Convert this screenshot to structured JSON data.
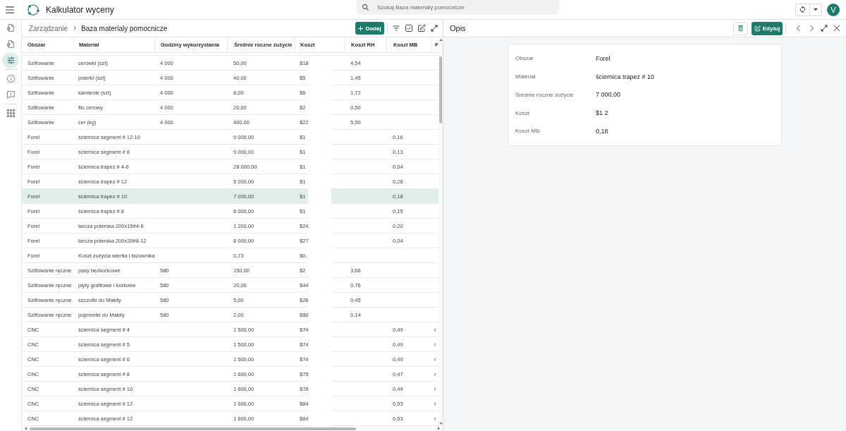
{
  "app": {
    "title": "Kalkulator wyceny",
    "search": {
      "placeholder": "Szukaj Baza materialy pomocnicze"
    },
    "avatar": "V"
  },
  "sidebar": {
    "groups": [
      {
        "items": [
          {
            "kind": "document",
            "selected": false
          },
          {
            "kind": "document",
            "selected": false
          },
          {
            "kind": "sliders",
            "selected": true
          }
        ]
      },
      {
        "items": [
          {
            "kind": "info",
            "selected": false
          },
          {
            "kind": "feedback",
            "selected": false
          }
        ]
      },
      {
        "items": [
          {
            "kind": "apps",
            "selected": false
          }
        ]
      }
    ]
  },
  "list_panel": {
    "breadcrumb": [
      "Zarządzanie",
      "Baza materialy pomocnicze"
    ],
    "add_button": "Dodaj",
    "table": {
      "columns": [
        "Obszar",
        "Materiał",
        "Godziny wykorzystania",
        "Średnie roczne zużycie",
        "Koszt",
        "Koszt RH",
        "Koszt MB",
        "F"
      ],
      "rows": [
        {
          "selected": false,
          "area": "Szlifowanie",
          "material": "cerówki (szt)",
          "usage_hours": "4 000",
          "avg_annual_use": "50,00",
          "cost": "$18",
          "cost_rh": "4,54"
        },
        {
          "selected": false,
          "area": "Szlifowanie",
          "material": "polerki (szt)",
          "usage_hours": "4 000",
          "avg_annual_use": "40,00",
          "cost": "$5",
          "cost_rh": "1,45"
        },
        {
          "selected": false,
          "area": "Szlifowanie",
          "material": "kamienie (szt)",
          "usage_hours": "4 000",
          "avg_annual_use": "8,00",
          "cost": "$6",
          "cost_rh": "1,72"
        },
        {
          "selected": false,
          "area": "Szlifowanie",
          "material": "filc cerowy",
          "usage_hours": "4 000",
          "avg_annual_use": "20,00",
          "cost": "$2",
          "cost_rh": "0,50"
        },
        {
          "selected": false,
          "area": "Szlifowanie",
          "material": "cer (kg)",
          "usage_hours": "4 000",
          "avg_annual_use": "400,00",
          "cost": "$22",
          "cost_rh": "5,50"
        },
        {
          "selected": false,
          "area": "Forel",
          "material": "ściernica segment # 12-10",
          "avg_annual_use": "9 000,00",
          "cost": "$1",
          "cost_mb": "0,16"
        },
        {
          "selected": false,
          "area": "Forel",
          "material": "ściernica segment # 8",
          "avg_annual_use": "9 000,00",
          "cost": "$1",
          "cost_mb": "0,13"
        },
        {
          "selected": false,
          "area": "Forel",
          "material": "ściernica trapez # 4-6",
          "avg_annual_use": "28 000,00",
          "cost": "$1",
          "cost_mb": "0,04"
        },
        {
          "selected": false,
          "area": "Forel",
          "material": "ściernica trapez # 12",
          "avg_annual_use": "5 000,00",
          "cost": "$1",
          "cost_mb": "0,28"
        },
        {
          "selected": true,
          "area": "Forel",
          "material": "ściernica trapez # 10",
          "avg_annual_use": "7 000,00",
          "cost": "$1",
          "cost_mb": "0,18"
        },
        {
          "selected": false,
          "area": "Forel",
          "material": "ściernica trapez # 8",
          "avg_annual_use": "8 000,00",
          "cost": "$1",
          "cost_mb": "0,15"
        },
        {
          "selected": false,
          "area": "Forel",
          "material": "tarcza polerska 200x15#4-6",
          "avg_annual_use": "1 200,00",
          "cost": "$24",
          "cost_mb": "0,20"
        },
        {
          "selected": false,
          "area": "Forel",
          "material": "tarcza polerska 200x20#8-12",
          "avg_annual_use": "8 000,00",
          "cost": "$27",
          "cost_mb": "0,04"
        },
        {
          "selected": false,
          "area": "Forel",
          "material": "Koszt zużycia wiertła i fazownika",
          "avg_annual_use": "0,73",
          "cost": "$0,"
        },
        {
          "selected": false,
          "area": "Szlifowanie ręczne",
          "material": "pasy bezkońcowe",
          "usage_hours": "580",
          "avg_annual_use": "150,00",
          "cost": "$2",
          "cost_rh": "3,66"
        },
        {
          "selected": false,
          "area": "Szlifowanie ręczne",
          "material": "płyty grafitowe i korkowe",
          "usage_hours": "580",
          "avg_annual_use": "20,00",
          "cost": "$44",
          "cost_rh": "0,76"
        },
        {
          "selected": false,
          "area": "Szlifowanie ręczne",
          "material": "szczotki do Makity",
          "usage_hours": "580",
          "avg_annual_use": "5,00",
          "cost": "$26",
          "cost_rh": "0,45"
        },
        {
          "selected": false,
          "area": "Szlifowanie ręczne",
          "material": "pojemniki do Makity",
          "usage_hours": "580",
          "avg_annual_use": "2,00",
          "cost": "$80",
          "cost_rh": "0,14"
        },
        {
          "selected": false,
          "area": "CNC",
          "material": "ściernica segment # 4",
          "avg_annual_use": "1 500,00",
          "cost": "$74",
          "cost_mb": "0,49",
          "column_8": "r"
        },
        {
          "selected": false,
          "area": "CNC",
          "material": "ściernica segment # 5",
          "avg_annual_use": "1 500,00",
          "cost": "$74",
          "cost_mb": "0,49",
          "column_8": "r"
        },
        {
          "selected": false,
          "area": "CNC",
          "material": "ściernica segment # 6",
          "avg_annual_use": "1 500,00",
          "cost": "$74",
          "cost_mb": "0,49",
          "column_8": "r"
        },
        {
          "selected": false,
          "area": "CNC",
          "material": "ściernica segment # 8",
          "avg_annual_use": "1 600,00",
          "cost": "$75",
          "cost_mb": "0,47",
          "column_8": "r"
        },
        {
          "selected": false,
          "area": "CNC",
          "material": "ściernica segment # 10",
          "avg_annual_use": "1 600,00",
          "cost": "$78",
          "cost_mb": "0,49",
          "column_8": "r"
        },
        {
          "selected": false,
          "area": "CNC",
          "material": "ściernica segment # 12",
          "avg_annual_use": "1 600,00",
          "cost": "$84",
          "cost_mb": "0,53",
          "column_8": "r"
        },
        {
          "selected": false,
          "area": "CNC",
          "material": "ściernica segment # 12",
          "avg_annual_use": "1 600,00",
          "cost": "$84",
          "cost_mb": "0,53",
          "column_8": "r"
        }
      ]
    }
  },
  "detail_panel": {
    "title": "Opis",
    "edit_button": "Edytuj",
    "fields": [
      {
        "label": "Obszar",
        "value": "Forel"
      },
      {
        "label": "Materiał",
        "value": "ściernica trapez # 10"
      },
      {
        "label": "Średnie roczne zużycie",
        "value": "7 000,00"
      },
      {
        "label": "Koszt",
        "value": "$1 2"
      },
      {
        "label": "Koszt MB",
        "value": "0,18"
      }
    ]
  }
}
